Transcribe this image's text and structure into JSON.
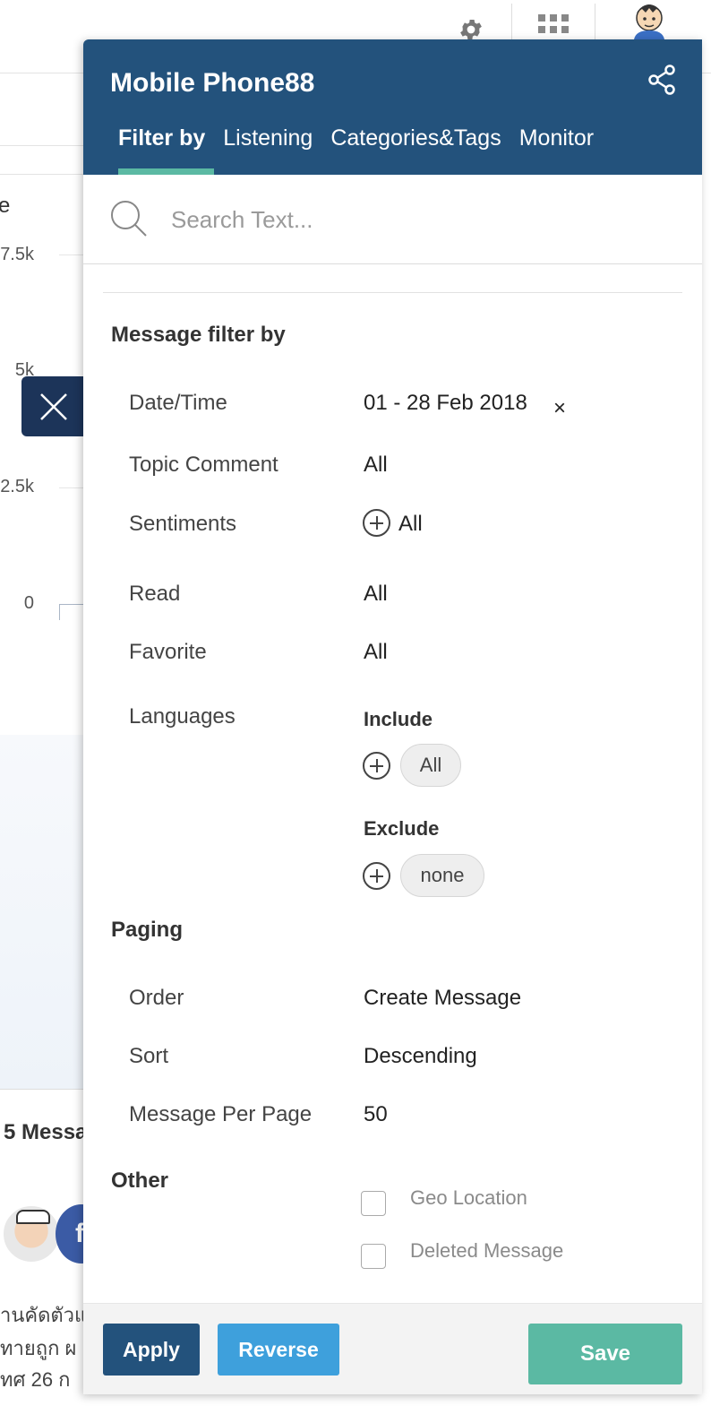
{
  "background": {
    "heading_fragment": "e",
    "y_ticks": [
      "7.5k",
      "5k",
      "2.5k",
      "0"
    ],
    "messages_fragment": "5 Messa",
    "thai_lines": [
      "านคัดตัวแ",
      "ทายถูก ผ",
      "ทศ 26 ก"
    ],
    "avatar2_letter": "f"
  },
  "panel": {
    "title": "Mobile Phone88",
    "tabs": [
      {
        "label": "Filter by",
        "active": true
      },
      {
        "label": "Listening",
        "active": false
      },
      {
        "label": "Categories&Tags",
        "active": false
      },
      {
        "label": "Monitor",
        "active": false
      }
    ],
    "search": {
      "placeholder": "Search Text..."
    },
    "message_filter": {
      "title": "Message filter by",
      "date_time_label": "Date/Time",
      "date_time_value": "01 - 28 Feb 2018",
      "date_time_clear": "×",
      "topic_comment_label": "Topic Comment",
      "topic_comment_value": "All",
      "sentiments_label": "Sentiments",
      "sentiments_value": "All",
      "read_label": "Read",
      "read_value": "All",
      "favorite_label": "Favorite",
      "favorite_value": "All",
      "languages_label": "Languages",
      "include_label": "Include",
      "include_value": "All",
      "exclude_label": "Exclude",
      "exclude_value": "none"
    },
    "paging": {
      "title": "Paging",
      "order_label": "Order",
      "order_value": "Create Message",
      "sort_label": "Sort",
      "sort_value": "Descending",
      "per_page_label": "Message Per Page",
      "per_page_value": "50"
    },
    "other": {
      "title": "Other",
      "geo_location_label": "Geo Location",
      "geo_location_checked": false,
      "deleted_message_label": "Deleted Message",
      "deleted_message_checked": false
    },
    "footer": {
      "apply": "Apply",
      "reverse": "Reverse",
      "save": "Save"
    }
  },
  "colors": {
    "header": "#23527c",
    "accent": "#5bb9a3",
    "reverse": "#3ea0dc",
    "close_button": "#1c3459"
  }
}
